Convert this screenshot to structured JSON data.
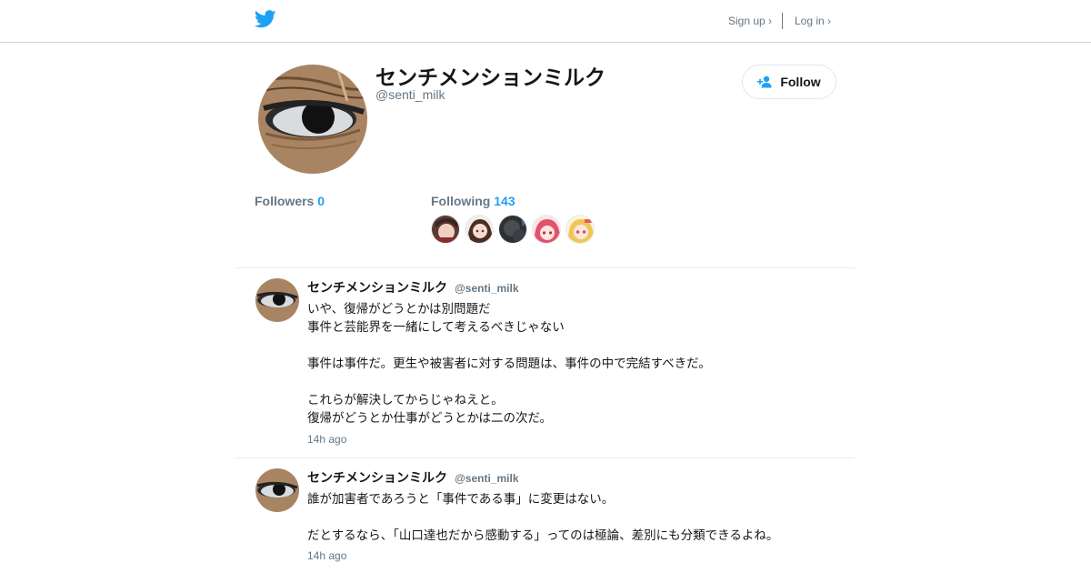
{
  "colors": {
    "accent": "#1da1f2",
    "muted": "#657786",
    "text": "#14171a",
    "border": "#e6ecf0"
  },
  "header": {
    "logo_icon": "twitter-bird-icon",
    "signup_label": "Sign up ›",
    "login_label": "Log in ›"
  },
  "profile": {
    "name": "センチメンションミルク",
    "handle": "@senti_milk",
    "follow_label": "Follow",
    "follow_icon": "add-person-icon",
    "followers_label": "Followers",
    "followers_count": "0",
    "following_label": "Following",
    "following_count": "143"
  },
  "tweets": [
    {
      "author": "センチメンションミルク",
      "handle": "@senti_milk",
      "lines": [
        "いや、復帰がどうとかは別問題だ",
        "事件と芸能界を一緒にして考えるべきじゃない",
        "",
        "事件は事件だ。更生や被害者に対する問題は、事件の中で完結すべきだ。",
        "",
        "これらが解決してからじゃねえと。",
        "復帰がどうとか仕事がどうとかは二の次だ。"
      ],
      "time": "14h ago"
    },
    {
      "author": "センチメンションミルク",
      "handle": "@senti_milk",
      "lines": [
        "誰が加害者であろうと「事件である事」に変更はない。",
        "",
        "だとするなら、「山口達也だから感動する」ってのは極論、差別にも分類できるよね。"
      ],
      "time": "14h ago"
    }
  ]
}
